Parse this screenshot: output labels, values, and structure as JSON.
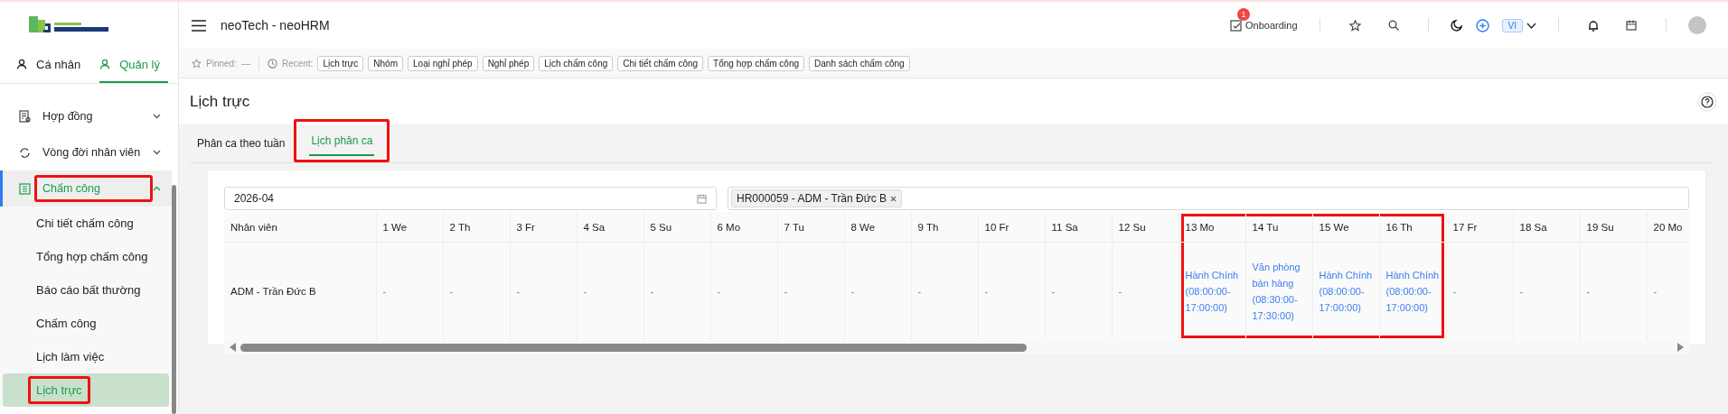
{
  "app_title": "neoTech - neoHRM",
  "sidebar": {
    "tabs": [
      {
        "label": "Cá nhân",
        "selected": false
      },
      {
        "label": "Quản lý",
        "selected": true
      }
    ],
    "items": [
      {
        "label": "Hợp đồng",
        "expanded": false,
        "selected": false,
        "highlighted": false
      },
      {
        "label": "Vòng đời nhân viên",
        "expanded": false,
        "selected": false,
        "highlighted": false
      },
      {
        "label": "Chấm công",
        "expanded": true,
        "selected": true,
        "highlighted": true,
        "children": [
          {
            "label": "Chi tiết chấm công",
            "selected": false,
            "highlighted": false
          },
          {
            "label": "Tổng hợp chấm công",
            "selected": false,
            "highlighted": false
          },
          {
            "label": "Báo cáo bất thường",
            "selected": false,
            "highlighted": false
          },
          {
            "label": "Chấm công",
            "selected": false,
            "highlighted": false
          },
          {
            "label": "Lịch làm việc",
            "selected": false,
            "highlighted": false
          },
          {
            "label": "Lịch trực",
            "selected": true,
            "highlighted": true
          }
        ]
      }
    ]
  },
  "header": {
    "onboarding": {
      "label": "Onboarding",
      "badge": "1"
    },
    "language": "VI"
  },
  "recent_bar": {
    "pinned_label": "Pinned:",
    "pinned_value": "—",
    "recent_label": "Recent:",
    "recent": [
      "Lịch trực",
      "Nhóm",
      "Loại nghỉ phép",
      "Nghỉ phép",
      "Lịch chấm công",
      "Chi tiết chấm công",
      "Tổng hợp chấm công",
      "Danh sách chấm công"
    ]
  },
  "page": {
    "title": "Lịch trực",
    "tabs": [
      {
        "label": "Phân ca theo tuần",
        "selected": false,
        "highlighted": false
      },
      {
        "label": "Lịch phân ca",
        "selected": true,
        "highlighted": true
      }
    ],
    "month_field": {
      "value": "2026-04"
    },
    "employee_filter": {
      "tags": [
        "HR000059 - ADM - Trần Đức B"
      ]
    },
    "table": {
      "first_column": "Nhân viên",
      "columns": [
        {
          "label": "1 We",
          "highlighted": false
        },
        {
          "label": "2 Th",
          "highlighted": false
        },
        {
          "label": "3 Fr",
          "highlighted": false
        },
        {
          "label": "4 Sa",
          "highlighted": false
        },
        {
          "label": "5 Su",
          "highlighted": false
        },
        {
          "label": "6 Mo",
          "highlighted": false
        },
        {
          "label": "7 Tu",
          "highlighted": false
        },
        {
          "label": "8 We",
          "highlighted": false
        },
        {
          "label": "9 Th",
          "highlighted": false
        },
        {
          "label": "10 Fr",
          "highlighted": false
        },
        {
          "label": "11 Sa",
          "highlighted": false
        },
        {
          "label": "12 Su",
          "highlighted": false
        },
        {
          "label": "13 Mo",
          "highlighted": true
        },
        {
          "label": "14 Tu",
          "highlighted": true
        },
        {
          "label": "15 We",
          "highlighted": true
        },
        {
          "label": "16 Th",
          "highlighted": true
        },
        {
          "label": "17 Fr",
          "highlighted": false
        },
        {
          "label": "18 Sa",
          "highlighted": false
        },
        {
          "label": "19 Su",
          "highlighted": false
        },
        {
          "label": "20 Mo",
          "highlighted": false
        }
      ],
      "rows": [
        {
          "employee": "ADM - Trần Đức B",
          "cells": [
            "-",
            "-",
            "-",
            "-",
            "-",
            "-",
            "-",
            "-",
            "-",
            "-",
            "-",
            "-",
            "Hành Chính (08:00:00-17:00:00)",
            "Văn phòng bán hàng (08:30:00-17:30:00)",
            "Hành Chính (08:00:00-17:00:00)",
            "Hành Chính (08:00:00-17:00:00)",
            "-",
            "-",
            "-",
            "-"
          ]
        }
      ]
    }
  }
}
